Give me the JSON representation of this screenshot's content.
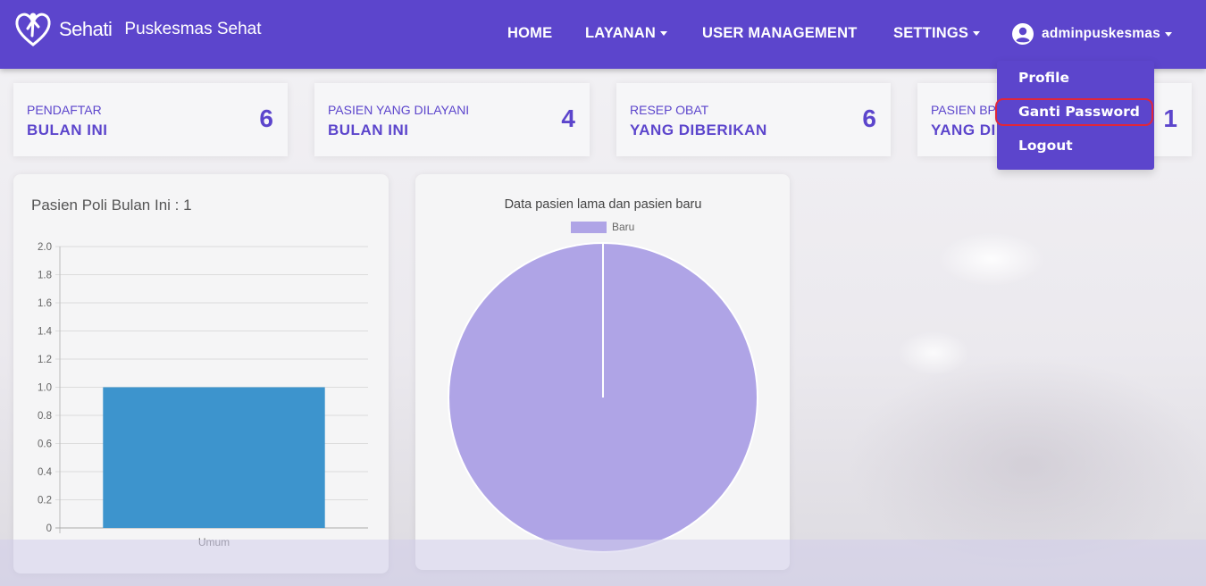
{
  "brand": {
    "name": "Sehati",
    "subtitle": "Puskesmas Sehat"
  },
  "nav": {
    "home": "HOME",
    "layanan": "LAYANAN",
    "user_management": "USER MANAGEMENT",
    "settings": "SETTINGS",
    "user": "adminpuskesmas"
  },
  "user_menu": {
    "profile": "Profile",
    "change_password": "Ganti Password",
    "logout": "Logout"
  },
  "stats": [
    {
      "label_top": "PENDAFTAR",
      "label_bottom": "BULAN INI",
      "value": "6"
    },
    {
      "label_top": "PASIEN YANG DILAYANI",
      "label_bottom": "BULAN INI",
      "value": "4"
    },
    {
      "label_top": "RESEP OBAT",
      "label_bottom": "YANG DIBERIKAN",
      "value": "6"
    },
    {
      "label_top": "PASIEN BP",
      "label_bottom": "YANG DI",
      "value": "1"
    }
  ],
  "colors": {
    "primary": "#5c45cc",
    "bar": "#3d94cd",
    "pie": "#afa4e6",
    "highlight": "#e0263a"
  },
  "chart_data": [
    {
      "type": "bar",
      "title": "Pasien Poli Bulan Ini : 1",
      "categories": [
        "Umum"
      ],
      "values": [
        1
      ],
      "ylim": [
        0,
        2
      ],
      "yticks": [
        "0",
        "0.2",
        "0.4",
        "0.6",
        "0.8",
        "1.0",
        "1.2",
        "1.4",
        "1.6",
        "1.8",
        "2.0"
      ],
      "grid": true
    },
    {
      "type": "pie",
      "title": "Data pasien lama dan pasien baru",
      "labels": [
        "Baru"
      ],
      "values": [
        1
      ],
      "legend": "top"
    }
  ]
}
